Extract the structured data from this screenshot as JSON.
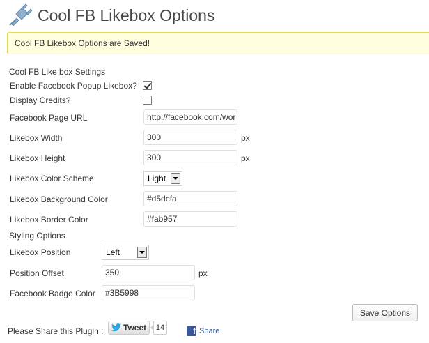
{
  "header": {
    "title": "Cool FB Likebox Options",
    "icon": "plug-icon"
  },
  "notice": {
    "text": "Cool FB Likebox Options are Saved!",
    "colors": {
      "background": "#ffffe0",
      "border": "#e6db55"
    }
  },
  "settings": {
    "section_label": "Cool FB Like box Settings",
    "enable_popup": {
      "label": "Enable Facebook Popup Likebox?",
      "checked": true
    },
    "display_credits": {
      "label": "Display Credits?",
      "checked": false
    },
    "page_url": {
      "label": "Facebook Page URL",
      "value": "http://facebook.com/wor"
    },
    "width": {
      "label": "Likebox Width",
      "value": "300",
      "unit": "px"
    },
    "height": {
      "label": "Likebox Height",
      "value": "300",
      "unit": "px"
    },
    "color_scheme": {
      "label": "Likebox Color Scheme",
      "value": "Light"
    },
    "bg_color": {
      "label": "Likebox Background Color",
      "value": "#d5dcfa"
    },
    "border_color": {
      "label": "Likebox Border Color",
      "value": "#fab957"
    }
  },
  "styling": {
    "section_label": "Styling Options",
    "position": {
      "label": "Likebox Position",
      "value": "Left"
    },
    "offset": {
      "label": "Position Offset",
      "value": "350",
      "unit": "px"
    },
    "badge_color": {
      "label": "Facebook Badge Color",
      "value": "#3B5998"
    }
  },
  "actions": {
    "save_label": "Save Options"
  },
  "share": {
    "label": "Please Share this Plugin :",
    "tweet_label": "Tweet",
    "tweet_count": "14",
    "fb_label": "Share"
  }
}
